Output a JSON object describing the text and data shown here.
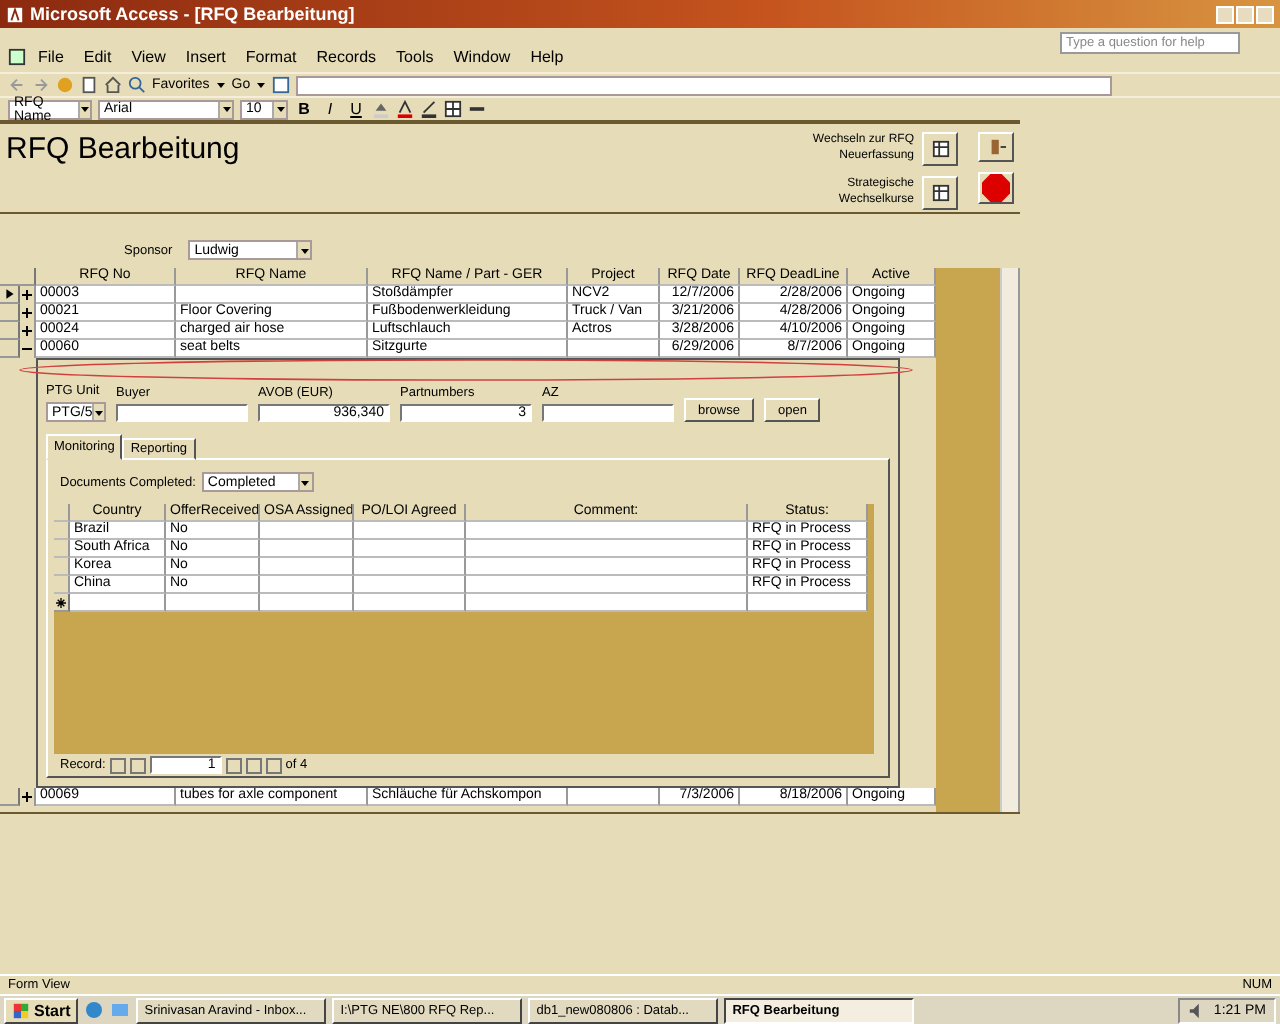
{
  "window": {
    "title": "Microsoft Access - [RFQ Bearbeitung]"
  },
  "menu": [
    "File",
    "Edit",
    "View",
    "Insert",
    "Format",
    "Records",
    "Tools",
    "Window",
    "Help"
  ],
  "help": {
    "placeholder": "Type a question for help"
  },
  "web_toolbar": {
    "favorites": "Favorites",
    "go": "Go"
  },
  "format_toolbar": {
    "object": "RFQ Name",
    "font": "Arial",
    "size": "10",
    "styles": [
      "B",
      "I",
      "U"
    ]
  },
  "form": {
    "title": "RFQ Bearbeitung",
    "header_buttons": [
      {
        "label": "Wechseln zur RFQ Neuerfassung"
      },
      {
        "label": "Strategische Wechselkurse"
      }
    ],
    "sponsor": {
      "label": "Sponsor",
      "value": "Ludwig"
    },
    "table": {
      "columns": [
        "RFQ No",
        "RFQ Name",
        "RFQ Name / Part - GER",
        "Project",
        "RFQ Date",
        "RFQ DeadLine",
        "Active"
      ],
      "rows": [
        {
          "selected": true,
          "expanded": false,
          "cells": [
            "00003",
            null,
            "Stoßdämpfer",
            "NCV2",
            "12/7/2006",
            "2/28/2006",
            "Ongoing"
          ]
        },
        {
          "selected": false,
          "expanded": false,
          "cells": [
            "00021",
            "Floor Covering",
            "Fußbodenwerkleidung",
            "Truck / Van",
            "3/21/2006",
            "4/28/2006",
            "Ongoing"
          ]
        },
        {
          "selected": false,
          "expanded": false,
          "cells": [
            "00024",
            "charged air hose",
            "Luftschlauch",
            "Actros",
            "3/28/2006",
            "4/10/2006",
            "Ongoing"
          ]
        },
        {
          "selected": false,
          "expanded": true,
          "cells": [
            "00060",
            "seat belts",
            "Sitzgurte",
            null,
            "6/29/2006",
            "8/7/2006",
            "Ongoing"
          ]
        }
      ],
      "after_rows": [
        {
          "selected": false,
          "expanded": false,
          "cells": [
            "00069",
            "tubes for axle component",
            "Schläuche für Achskompon",
            null,
            "7/3/2006",
            "8/18/2006",
            "Ongoing"
          ]
        }
      ]
    },
    "subform": {
      "fields": [
        {
          "label": "PTG Unit",
          "value": "PTG/5",
          "kind": "combo"
        },
        {
          "label": "Buyer",
          "kind": "text"
        },
        {
          "label": "AVOB (EUR)",
          "value": "936,340",
          "kind": "number"
        },
        {
          "label": "Partnumbers",
          "value": "3",
          "kind": "number"
        },
        {
          "label": "AZ",
          "kind": "text"
        }
      ],
      "buttons": [
        "browse",
        "open"
      ],
      "tabs": [
        {
          "label": "Monitoring",
          "selected": true
        },
        {
          "label": "Reporting",
          "selected": false
        }
      ],
      "documents": {
        "label": "Documents Completed:",
        "value": "Completed"
      },
      "table": {
        "columns": [
          "Country",
          "OfferReceived",
          "OSA Assigned",
          "PO/LOI Agreed",
          "Comment:",
          "Status:"
        ],
        "rows": [
          [
            "Brazil",
            "No",
            null,
            null,
            null,
            "RFQ in Process"
          ],
          [
            "South Africa",
            "No",
            null,
            null,
            null,
            "RFQ in Process"
          ],
          [
            "Korea",
            "No",
            null,
            null,
            null,
            "RFQ in Process"
          ],
          [
            "China",
            "No",
            null,
            null,
            null,
            "RFQ in Process"
          ]
        ]
      },
      "navigator": {
        "label": "Record:",
        "current": "1",
        "total": "of 4"
      }
    }
  },
  "status_bar": {
    "mode": "Form View",
    "indicator": "NUM"
  },
  "taskbar": {
    "start": "Start",
    "tasks": [
      {
        "label": "Srinivasan Aravind - Inbox...",
        "selected": false
      },
      {
        "label": "I:\\PTG NE\\800 RFQ Rep...",
        "selected": false
      },
      {
        "label": "db1_new080806 : Datab...",
        "selected": false
      },
      {
        "label": "RFQ Bearbeitung",
        "selected": true
      }
    ],
    "clock": "1:21 PM"
  }
}
